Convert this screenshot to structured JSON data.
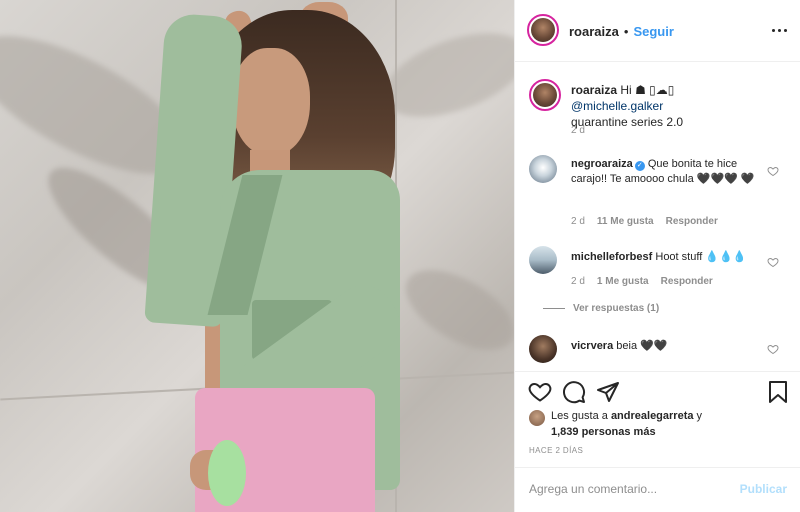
{
  "post": {
    "author": "roaraiza",
    "separator": "•",
    "follow_label": "Seguir",
    "photo_alt": "Foto de la publicación"
  },
  "caption": {
    "username": "roaraiza",
    "text_before": "Hi",
    "emoji": "☗ ▯☁▯",
    "mention": "@michelle.galker",
    "line2": "quarantine series 2.0",
    "time": "2 d"
  },
  "comments": [
    {
      "username": "negroaraiza",
      "verified": true,
      "text": "Que bonita te hice carajo!! Te amoooo chula",
      "hearts": "🖤🖤🖤 🖤",
      "time": "2 d",
      "likes": "11 Me gusta",
      "reply": "Responder"
    },
    {
      "username": "michelleforbesf",
      "verified": false,
      "text": "Hoot stuff",
      "hearts": "💧💧💧",
      "time": "2 d",
      "likes": "1 Me gusta",
      "reply": "Responder",
      "view_replies": "Ver respuestas (1)"
    },
    {
      "username": "vicrvera",
      "verified": false,
      "text": "beia",
      "hearts": "🖤🖤",
      "time": "",
      "likes": "",
      "reply": ""
    }
  ],
  "likes": {
    "prefix": "Les gusta a",
    "user": "andrealegarreta",
    "joiner": "y",
    "count": "1,839 personas más"
  },
  "time_ago": "HACE 2 DÍAS",
  "comment_box": {
    "placeholder": "Agrega un comentario...",
    "post_label": "Publicar"
  },
  "icons": {
    "like": "heart-icon",
    "comment": "comment-icon",
    "share": "share-icon",
    "save": "bookmark-icon",
    "more": "more-options-icon"
  },
  "colors": {
    "link": "#3897f0",
    "mention": "#003569",
    "muted": "#8e8e8e",
    "post_disabled": "#b2dffc"
  }
}
